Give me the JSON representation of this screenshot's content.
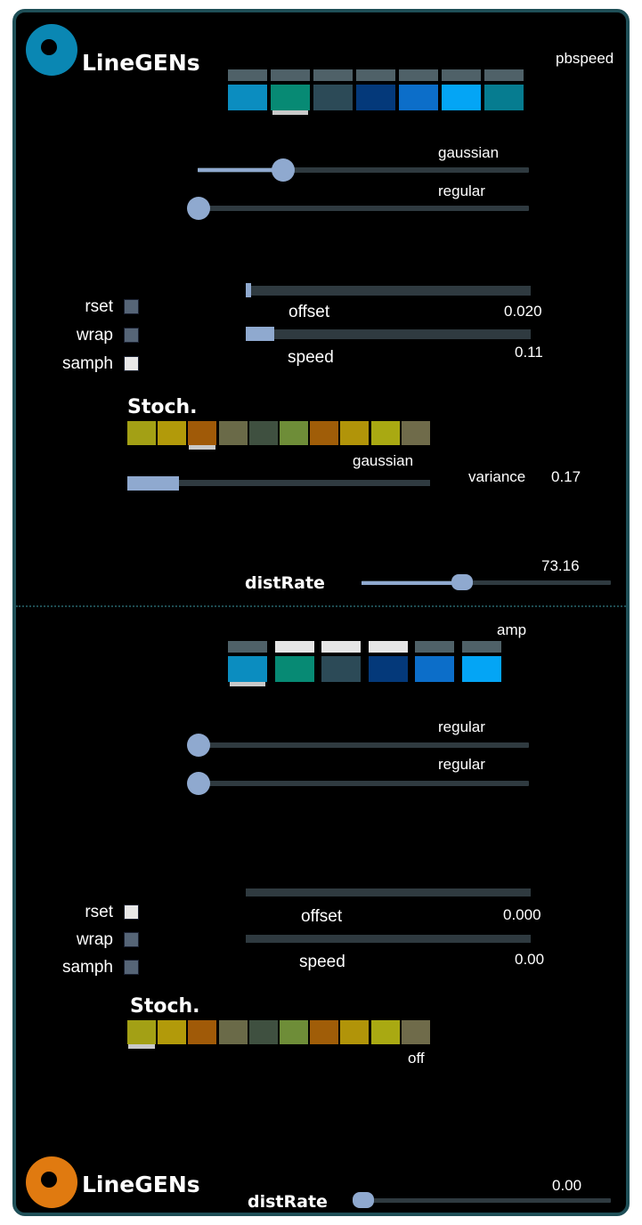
{
  "top": {
    "title": "LineGENs",
    "param_label": "pbspeed",
    "color_tabs": [
      "#4f6168",
      "#4f6168",
      "#4f6168",
      "#4f6168",
      "#4f6168",
      "#4f6168",
      "#4f6168"
    ],
    "colors": [
      "#0b8dc0",
      "#078a74",
      "#2c4a57",
      "#04397a",
      "#0c6ec9",
      "#04a5f5",
      "#067c90"
    ],
    "selected_color": 1,
    "dist1": {
      "label": "gaussian",
      "value": 0.25
    },
    "dist2": {
      "label": "regular",
      "value": 0.0
    },
    "checkboxes": [
      {
        "label": "rset",
        "checked": false
      },
      {
        "label": "wrap",
        "checked": false
      },
      {
        "label": "samph",
        "checked": true
      }
    ],
    "offset": {
      "label": "offset",
      "value": "0.020",
      "fraction": 0.02
    },
    "speed": {
      "label": "speed",
      "value": "0.11",
      "fraction": 0.11
    },
    "stoch": {
      "title": "Stoch.",
      "colors": [
        "#a3a015",
        "#b29a0a",
        "#a05a08",
        "#6a6a48",
        "#3f5040",
        "#6e8d38",
        "#a05d08",
        "#b19409",
        "#a9a912",
        "#6f6b4a"
      ],
      "selected": 2,
      "dist_label": "gaussian",
      "variance_label": "variance",
      "variance_value": "0.17",
      "variance_fraction": 0.17
    },
    "distRate": {
      "label": "distRate",
      "value": "73.16",
      "fraction": 0.4
    }
  },
  "bottom": {
    "title": "LineGENs",
    "param_label": "amp",
    "color_tabs": [
      "#4f6168",
      "#e6e6e6",
      "#e6e6e6",
      "#e6e6e6",
      "#4f6168",
      "#4f6168"
    ],
    "colors": [
      "#0b8dc0",
      "#078a74",
      "#2c4a57",
      "#04397a",
      "#0c6ec9",
      "#04a5f5"
    ],
    "selected_color": 0,
    "dist1": {
      "label": "regular",
      "value": 0.0
    },
    "dist2": {
      "label": "regular",
      "value": 0.0
    },
    "checkboxes": [
      {
        "label": "rset",
        "checked": true
      },
      {
        "label": "wrap",
        "checked": false
      },
      {
        "label": "samph",
        "checked": false
      }
    ],
    "offset": {
      "label": "offset",
      "value": "0.000",
      "fraction": 0.0
    },
    "speed": {
      "label": "speed",
      "value": "0.00",
      "fraction": 0.0
    },
    "stoch": {
      "title": "Stoch.",
      "colors": [
        "#a3a015",
        "#b29a0a",
        "#a05a08",
        "#6a6a48",
        "#3f5040",
        "#6e8d38",
        "#a05d08",
        "#b19409",
        "#a9a912",
        "#6f6b4a"
      ],
      "selected": 0,
      "dist_label": "off"
    },
    "distRate": {
      "label": "distRate",
      "value": "0.00",
      "fraction": 0.0
    }
  },
  "accent": {
    "top_logo": "#0a87b3",
    "bottom_logo": "#e07a10",
    "frame": "#1f4f57",
    "slider": "#8fa9cf"
  }
}
